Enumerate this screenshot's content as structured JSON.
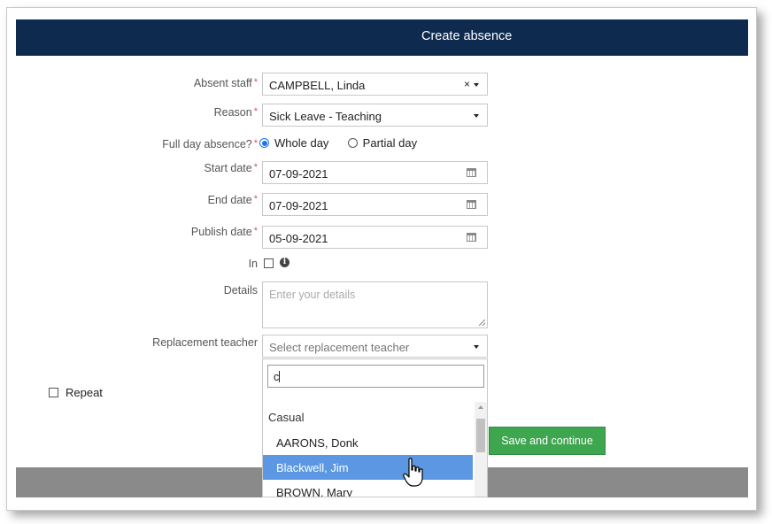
{
  "header": {
    "title": "Create absence"
  },
  "form": {
    "absent_staff": {
      "label": "Absent staff",
      "required": "*",
      "value": "CAMPBELL, Linda",
      "clear": "×"
    },
    "reason": {
      "label": "Reason",
      "required": "*",
      "value": "Sick Leave - Teaching"
    },
    "full_day": {
      "label": "Full day absence?",
      "required": "*",
      "options": [
        "Whole day",
        "Partial day"
      ],
      "selected": "Whole day"
    },
    "start_date": {
      "label": "Start date",
      "required": "*",
      "value": "07-09-2021"
    },
    "end_date": {
      "label": "End date",
      "required": "*",
      "value": "07-09-2021"
    },
    "publish_date": {
      "label": "Publish date",
      "required": "*",
      "value": "05-09-2021"
    },
    "in": {
      "label": "In",
      "info": "i"
    },
    "details": {
      "label": "Details",
      "placeholder": "Enter your details"
    },
    "replacement": {
      "label": "Replacement teacher",
      "placeholder": "Select replacement teacher"
    },
    "repeat": {
      "label": "Repeat"
    }
  },
  "dropdown": {
    "search_value": "c",
    "group": "Casual",
    "items": [
      "AARONS, Donk",
      "Blackwell, Jim",
      "BROWN, Mary"
    ],
    "highlighted": "Blackwell, Jim"
  },
  "actions": {
    "save_continue": "Save and continue"
  },
  "colors": {
    "header_bg": "#0e2a4f",
    "save_button": "#3fa650",
    "highlight": "#5b97e3"
  }
}
